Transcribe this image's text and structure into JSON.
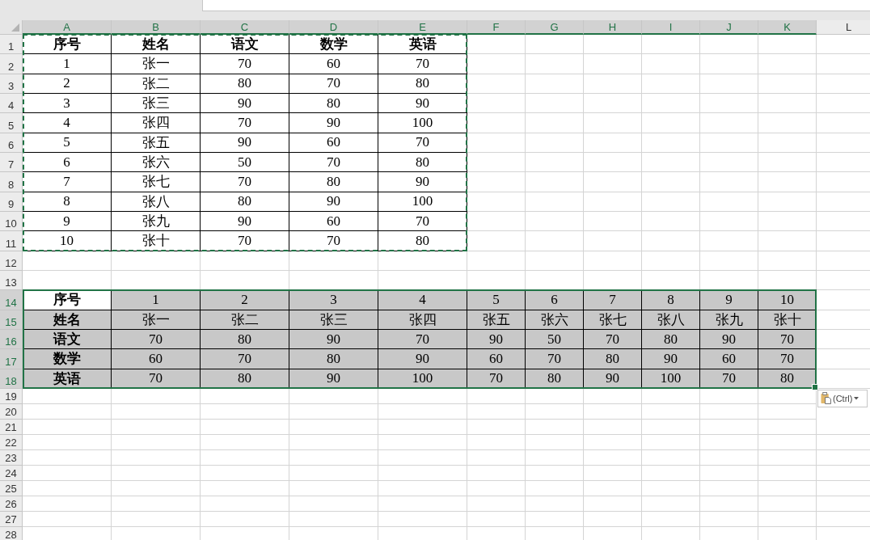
{
  "column_headers": [
    {
      "label": "A",
      "selected": true
    },
    {
      "label": "B",
      "selected": true
    },
    {
      "label": "C",
      "selected": true
    },
    {
      "label": "D",
      "selected": true
    },
    {
      "label": "E",
      "selected": true
    },
    {
      "label": "F",
      "selected": true
    },
    {
      "label": "G",
      "selected": true
    },
    {
      "label": "H",
      "selected": true
    },
    {
      "label": "I",
      "selected": true
    },
    {
      "label": "J",
      "selected": true
    },
    {
      "label": "K",
      "selected": true
    },
    {
      "label": "L",
      "selected": false
    }
  ],
  "row_headers": [
    {
      "label": "1",
      "selected": false
    },
    {
      "label": "2",
      "selected": false
    },
    {
      "label": "3",
      "selected": false
    },
    {
      "label": "4",
      "selected": false
    },
    {
      "label": "5",
      "selected": false
    },
    {
      "label": "6",
      "selected": false
    },
    {
      "label": "7",
      "selected": false
    },
    {
      "label": "8",
      "selected": false
    },
    {
      "label": "9",
      "selected": false
    },
    {
      "label": "10",
      "selected": false
    },
    {
      "label": "11",
      "selected": false
    },
    {
      "label": "12",
      "selected": false
    },
    {
      "label": "13",
      "selected": false
    },
    {
      "label": "14",
      "selected": true
    },
    {
      "label": "15",
      "selected": true
    },
    {
      "label": "16",
      "selected": true
    },
    {
      "label": "17",
      "selected": true
    },
    {
      "label": "18",
      "selected": true
    },
    {
      "label": "19",
      "selected": false
    },
    {
      "label": "20",
      "selected": false
    },
    {
      "label": "21",
      "selected": false
    },
    {
      "label": "22",
      "selected": false
    },
    {
      "label": "23",
      "selected": false
    },
    {
      "label": "24",
      "selected": false
    },
    {
      "label": "25",
      "selected": false
    },
    {
      "label": "26",
      "selected": false
    },
    {
      "label": "27",
      "selected": false
    },
    {
      "label": "28",
      "selected": false
    }
  ],
  "source_table": {
    "rows": [
      [
        "序号",
        "姓名",
        "语文",
        "数学",
        "英语"
      ],
      [
        "1",
        "张一",
        "70",
        "60",
        "70"
      ],
      [
        "2",
        "张二",
        "80",
        "70",
        "80"
      ],
      [
        "3",
        "张三",
        "90",
        "80",
        "90"
      ],
      [
        "4",
        "张四",
        "70",
        "90",
        "100"
      ],
      [
        "5",
        "张五",
        "90",
        "60",
        "70"
      ],
      [
        "6",
        "张六",
        "50",
        "70",
        "80"
      ],
      [
        "7",
        "张七",
        "70",
        "80",
        "90"
      ],
      [
        "8",
        "张八",
        "80",
        "90",
        "100"
      ],
      [
        "9",
        "张九",
        "90",
        "60",
        "70"
      ],
      [
        "10",
        "张十",
        "70",
        "70",
        "80"
      ]
    ]
  },
  "pasted_table": {
    "rows": [
      [
        "序号",
        "1",
        "2",
        "3",
        "4",
        "5",
        "6",
        "7",
        "8",
        "9",
        "10"
      ],
      [
        "姓名",
        "张一",
        "张二",
        "张三",
        "张四",
        "张五",
        "张六",
        "张七",
        "张八",
        "张九",
        "张十"
      ],
      [
        "语文",
        "70",
        "80",
        "90",
        "70",
        "90",
        "50",
        "70",
        "80",
        "90",
        "70"
      ],
      [
        "数学",
        "60",
        "70",
        "80",
        "90",
        "60",
        "70",
        "80",
        "90",
        "60",
        "70"
      ],
      [
        "英语",
        "70",
        "80",
        "90",
        "100",
        "70",
        "80",
        "90",
        "100",
        "70",
        "80"
      ]
    ]
  },
  "paste_options": {
    "label": "(Ctrl)"
  }
}
